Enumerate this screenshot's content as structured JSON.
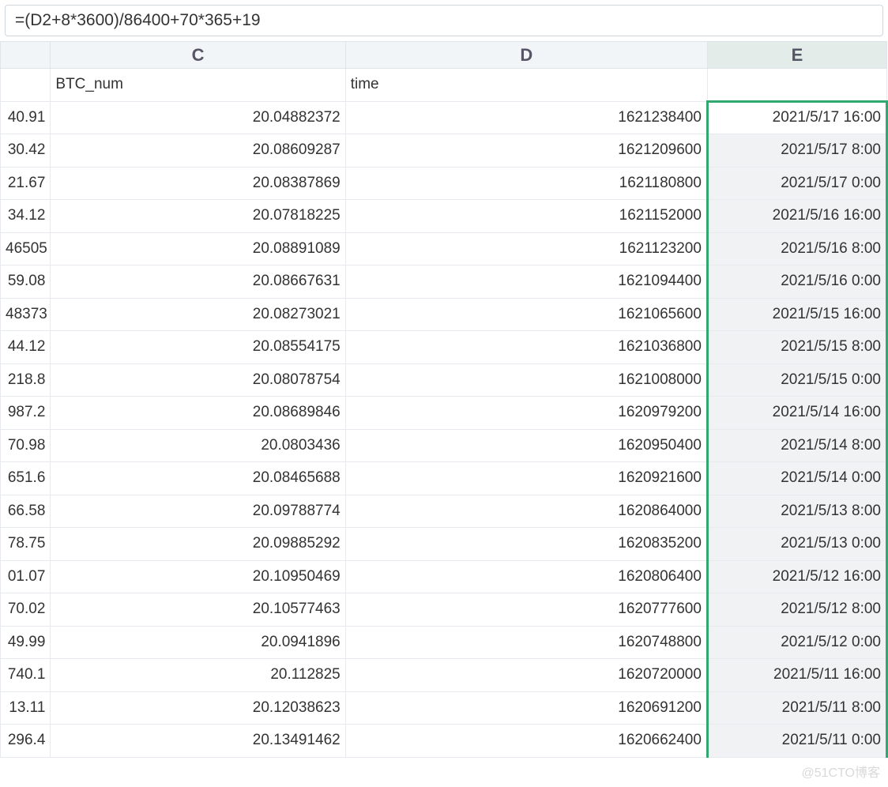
{
  "formula_bar": {
    "value": "=(D2+8*3600)/86400+70*365+19"
  },
  "columns": {
    "c": "C",
    "d": "D",
    "e": "E"
  },
  "headers": {
    "c": "BTC_num",
    "d": "time",
    "e": ""
  },
  "rows": [
    {
      "b": "40.91",
      "c": "20.04882372",
      "d": "1621238400",
      "e": "2021/5/17 16:00"
    },
    {
      "b": "30.42",
      "c": "20.08609287",
      "d": "1621209600",
      "e": "2021/5/17 8:00"
    },
    {
      "b": "21.67",
      "c": "20.08387869",
      "d": "1621180800",
      "e": "2021/5/17 0:00"
    },
    {
      "b": "34.12",
      "c": "20.07818225",
      "d": "1621152000",
      "e": "2021/5/16 16:00"
    },
    {
      "b": "46505",
      "c": "20.08891089",
      "d": "1621123200",
      "e": "2021/5/16 8:00"
    },
    {
      "b": "59.08",
      "c": "20.08667631",
      "d": "1621094400",
      "e": "2021/5/16 0:00"
    },
    {
      "b": "48373",
      "c": "20.08273021",
      "d": "1621065600",
      "e": "2021/5/15 16:00"
    },
    {
      "b": "44.12",
      "c": "20.08554175",
      "d": "1621036800",
      "e": "2021/5/15 8:00"
    },
    {
      "b": "218.8",
      "c": "20.08078754",
      "d": "1621008000",
      "e": "2021/5/15 0:00"
    },
    {
      "b": "987.2",
      "c": "20.08689846",
      "d": "1620979200",
      "e": "2021/5/14 16:00"
    },
    {
      "b": "70.98",
      "c": "20.0803436",
      "d": "1620950400",
      "e": "2021/5/14 8:00"
    },
    {
      "b": "651.6",
      "c": "20.08465688",
      "d": "1620921600",
      "e": "2021/5/14 0:00"
    },
    {
      "b": "66.58",
      "c": "20.09788774",
      "d": "1620864000",
      "e": "2021/5/13 8:00"
    },
    {
      "b": "78.75",
      "c": "20.09885292",
      "d": "1620835200",
      "e": "2021/5/13 0:00"
    },
    {
      "b": "01.07",
      "c": "20.10950469",
      "d": "1620806400",
      "e": "2021/5/12 16:00"
    },
    {
      "b": "70.02",
      "c": "20.10577463",
      "d": "1620777600",
      "e": "2021/5/12 8:00"
    },
    {
      "b": "49.99",
      "c": "20.0941896",
      "d": "1620748800",
      "e": "2021/5/12 0:00"
    },
    {
      "b": "740.1",
      "c": "20.112825",
      "d": "1620720000",
      "e": "2021/5/11 16:00"
    },
    {
      "b": "13.11",
      "c": "20.12038623",
      "d": "1620691200",
      "e": "2021/5/11 8:00"
    },
    {
      "b": "296.4",
      "c": "20.13491462",
      "d": "1620662400",
      "e": "2021/5/11 0:00"
    }
  ],
  "watermark": "@51CTO博客"
}
